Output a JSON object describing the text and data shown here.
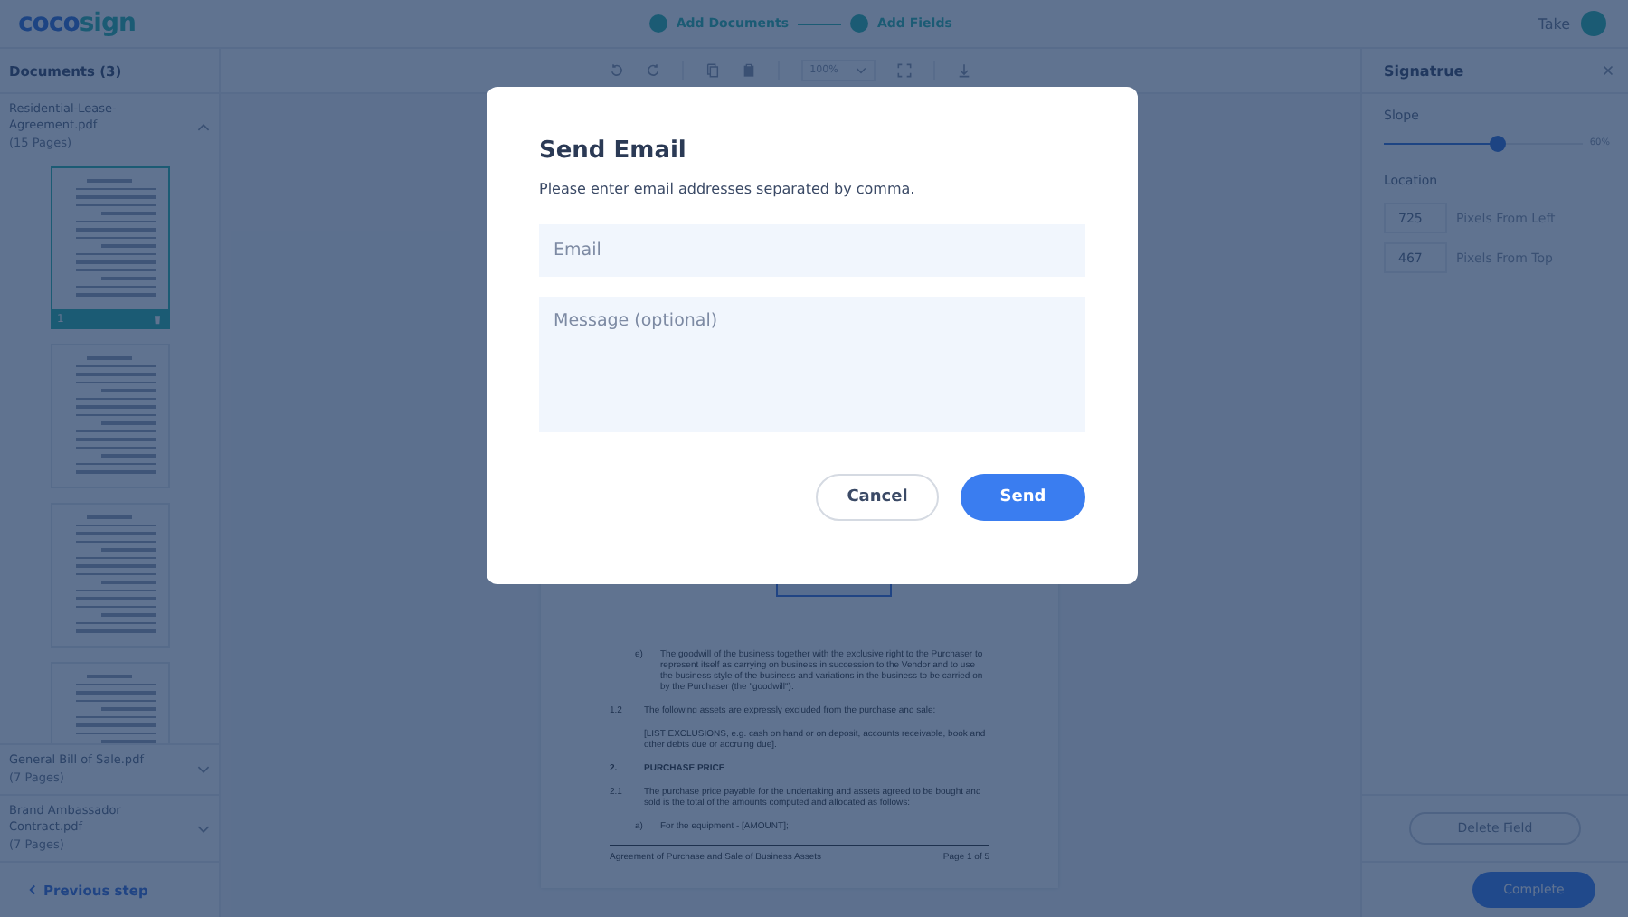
{
  "header": {
    "logo": [
      "coco",
      "sign"
    ],
    "steps": [
      "Add Documents",
      "Add Fields"
    ],
    "user": "Take"
  },
  "documents": {
    "title": "Documents (3)",
    "items": [
      {
        "name": "Residential-Lease-Agreement.pdf",
        "pages": "(15 Pages)",
        "expanded": true,
        "thumbnails": [
          {
            "selected": true,
            "number": "1"
          },
          {
            "selected": false
          },
          {
            "selected": false
          },
          {
            "selected": false
          }
        ]
      },
      {
        "name": "General Bill of Sale.pdf",
        "pages": "(7 Pages)",
        "expanded": false
      },
      {
        "name": "Brand Ambassador Contract.pdf",
        "pages": "(7 Pages)",
        "expanded": false
      }
    ]
  },
  "previous_step": "Previous step",
  "toolbar": {
    "zoom": "100%"
  },
  "document": {
    "paragraphs": [
      {
        "kind": "sub",
        "num": "e)",
        "text": "The goodwill of the business together with the exclusive right to the Purchaser to represent itself as carrying on business in succession to the Vendor and to use the business style of the business and variations in the business to be carried on by the Purchaser (the \"goodwill\")."
      },
      {
        "kind": "item",
        "num": "1.2",
        "text": "The following assets are expressly excluded from the purchase and sale:"
      },
      {
        "kind": "plain",
        "text": "[LIST EXCLUSIONS, e.g. cash on hand or on deposit, accounts receivable, book and other debts due or accruing due]."
      },
      {
        "kind": "heading",
        "num": "2.",
        "text": "PURCHASE PRICE"
      },
      {
        "kind": "item",
        "num": "2.1",
        "text": "The purchase price payable for the undertaking and assets agreed to be bought and sold is the total of the amounts computed and allocated as follows:"
      },
      {
        "kind": "sub",
        "num": "a)",
        "text": "For the equipment - [AMOUNT];"
      }
    ],
    "footer_left": "Agreement of Purchase and Sale of Business Assets",
    "footer_right": "Page 1 of 5"
  },
  "panel": {
    "title": "Signatrue",
    "slope": {
      "label": "Slope",
      "level": 0.57,
      "reading": "60%"
    },
    "location": {
      "label": "Location",
      "fields": [
        {
          "value": "725",
          "caption": "Pixels From Left"
        },
        {
          "value": "467",
          "caption": "Pixels From Top"
        }
      ]
    },
    "delete": "Delete Field",
    "complete": "Complete"
  },
  "modal": {
    "title": "Send Email",
    "subtitle": "Please enter email addresses separated by comma.",
    "email_placeholder": "Email",
    "message_placeholder": "Message (optional)",
    "cancel": "Cancel",
    "send": "Send"
  }
}
